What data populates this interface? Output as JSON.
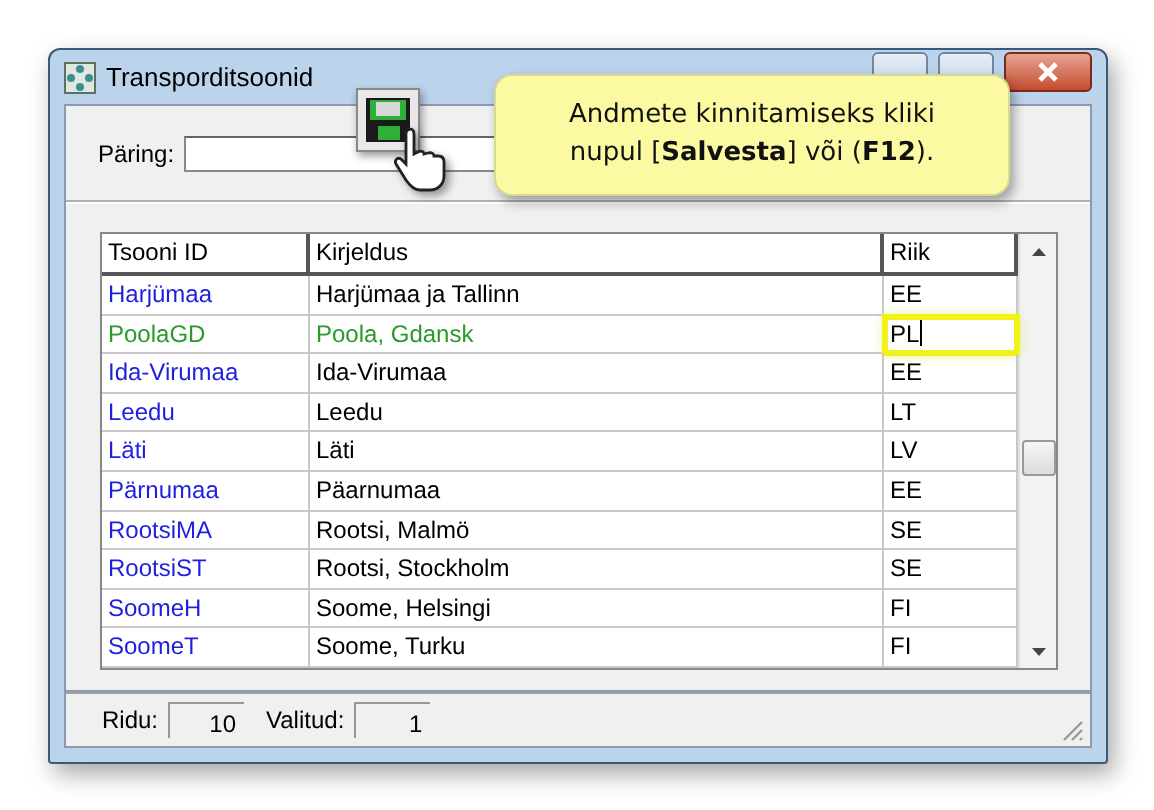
{
  "window": {
    "title": "Transporditsoonid"
  },
  "query": {
    "label": "Päring:"
  },
  "callout": {
    "text": "Andmete kinnitamiseks kliki nupul [**Salvesta**] või (**F12**)."
  },
  "table": {
    "columns": [
      "Tsooni ID",
      "Kirjeldus",
      "Riik"
    ],
    "rows": [
      {
        "id": "Harjümaa",
        "description": "Harjümaa ja Tallinn",
        "country": "EE",
        "selected": false,
        "editing": false
      },
      {
        "id": "PoolaGD",
        "description": "Poola, Gdansk",
        "country": "PL",
        "selected": true,
        "editing": true
      },
      {
        "id": "Ida-Virumaa",
        "description": "Ida-Virumaa",
        "country": "EE",
        "selected": false,
        "editing": false
      },
      {
        "id": "Leedu",
        "description": "Leedu",
        "country": "LT",
        "selected": false,
        "editing": false
      },
      {
        "id": "Läti",
        "description": "Läti",
        "country": "LV",
        "selected": false,
        "editing": false
      },
      {
        "id": "Pärnumaa",
        "description": "Päarnumaa",
        "country": "EE",
        "selected": false,
        "editing": false
      },
      {
        "id": "RootsiMA",
        "description": "Rootsi, Malmö",
        "country": "SE",
        "selected": false,
        "editing": false
      },
      {
        "id": "RootsiST",
        "description": "Rootsi, Stockholm",
        "country": "SE",
        "selected": false,
        "editing": false
      },
      {
        "id": "SoomeH",
        "description": "Soome, Helsingi",
        "country": "FI",
        "selected": false,
        "editing": false
      },
      {
        "id": "SoomeT",
        "description": "Soome, Turku",
        "country": "FI",
        "selected": false,
        "editing": false
      }
    ]
  },
  "status_bar": [
    {
      "label": "Ridu:",
      "value": "10"
    },
    {
      "label": "Valitud:",
      "value": "1"
    }
  ]
}
